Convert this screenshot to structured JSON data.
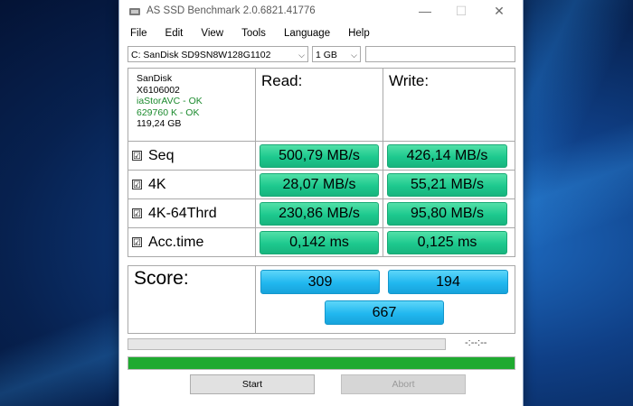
{
  "window": {
    "title": "AS SSD Benchmark 2.0.6821.41776",
    "minimize_glyph": "—",
    "maximize_glyph": "☐",
    "close_glyph": "✕"
  },
  "menu": [
    "File",
    "Edit",
    "View",
    "Tools",
    "Language",
    "Help"
  ],
  "toolbar": {
    "drive_value": "C: SanDisk SD9SN8W128G1102",
    "size_value": "1 GB",
    "dropdown_glyph": "⌵",
    "text_value": ""
  },
  "drive_info": {
    "vendor": "SanDisk",
    "firmware": "X6106002",
    "driver_status": "iaStorAVC - OK",
    "alignment_status": "629760 K - OK",
    "capacity": "119,24 GB"
  },
  "headers": {
    "read": "Read:",
    "write": "Write:"
  },
  "checkbox_glyph": "☑",
  "tests": [
    {
      "label": "Seq",
      "read": "500,79 MB/s",
      "write": "426,14 MB/s"
    },
    {
      "label": "4K",
      "read": "28,07 MB/s",
      "write": "55,21 MB/s"
    },
    {
      "label": "4K-64Thrd",
      "read": "230,86 MB/s",
      "write": "95,80 MB/s"
    },
    {
      "label": "Acc.time",
      "read": "0,142 ms",
      "write": "0,125 ms"
    }
  ],
  "score": {
    "label": "Score:",
    "read": "309",
    "write": "194",
    "total": "667"
  },
  "status": {
    "elapsed": "-:--:--",
    "progress_fraction": 1.0
  },
  "buttons": {
    "start": "Start",
    "abort": "Abort"
  },
  "colors": {
    "result_green": "#1dc98e",
    "score_blue": "#21b7ef",
    "progress_green": "#1faa30"
  }
}
